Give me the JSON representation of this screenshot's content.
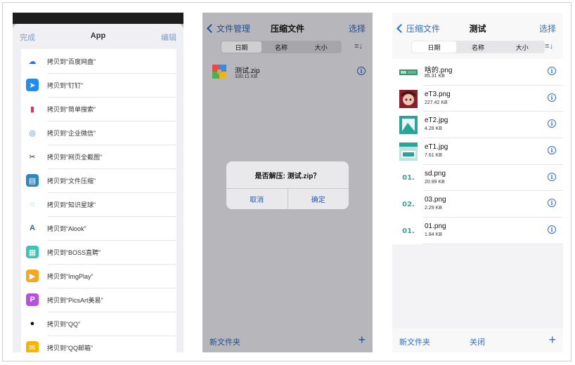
{
  "share_sheet": {
    "done": "完成",
    "title": "App",
    "edit": "编辑",
    "items": [
      {
        "label": "拷贝到“百度网盘”",
        "icon": "baidu-netdisk-icon",
        "color": "#ffffff",
        "fg": "#2b6be6",
        "glyph": "☁"
      },
      {
        "label": "拷贝到“钉钉”",
        "icon": "dingtalk-icon",
        "color": "#1e8cf0",
        "fg": "#ffffff",
        "glyph": "➤"
      },
      {
        "label": "拷贝到“简单搜索”",
        "icon": "simple-search-icon",
        "color": "#ffffff",
        "fg": "#e0306a",
        "glyph": "▮"
      },
      {
        "label": "拷贝到“企业微信”",
        "icon": "wecom-icon",
        "color": "#ffffff",
        "fg": "#3a8ef0",
        "glyph": "◎"
      },
      {
        "label": "拷贝到“网页全截图”",
        "icon": "scissors-icon",
        "color": "#ffffff",
        "fg": "#333333",
        "glyph": "✂"
      },
      {
        "label": "拷贝到“文件压缩”",
        "icon": "file-compress-icon",
        "color": "#2e86c1",
        "fg": "#ffffff",
        "glyph": "▤"
      },
      {
        "label": "拷贝到“知识星球”",
        "icon": "knowledge-planet-icon",
        "color": "#ffffff",
        "fg": "#3bc0a0",
        "glyph": "◌"
      },
      {
        "label": "拷贝到“Alook”",
        "icon": "alook-icon",
        "color": "#ffffff",
        "fg": "#2266cc",
        "glyph": "A"
      },
      {
        "label": "拷贝到“BOSS直聘”",
        "icon": "boss-zhipin-icon",
        "color": "#3cc4b4",
        "fg": "#ffffff",
        "glyph": "▦"
      },
      {
        "label": "拷贝到“ImgPlay”",
        "icon": "imgplay-icon",
        "color": "#f5a623",
        "fg": "#ffffff",
        "glyph": "▶"
      },
      {
        "label": "拷贝到“PicsArt美易”",
        "icon": "picsart-icon",
        "color": "#b84fe0",
        "fg": "#ffffff",
        "glyph": "P"
      },
      {
        "label": "拷贝到“QQ”",
        "icon": "qq-icon",
        "color": "#ffffff",
        "fg": "#111111",
        "glyph": "●"
      },
      {
        "label": "拷贝到“QQ邮箱”",
        "icon": "qq-mail-icon",
        "color": "#f7b500",
        "fg": "#ffffff",
        "glyph": "✉"
      }
    ]
  },
  "zip_view": {
    "back_label": "文件管理",
    "title": "压缩文件",
    "select": "选择",
    "segments": [
      "日期",
      "名称",
      "大小"
    ],
    "file": {
      "name": "测试.zip",
      "size": "330.11 KB"
    },
    "alert": {
      "message": "是否解压: 测试.zip？",
      "cancel": "取消",
      "confirm": "确定"
    },
    "new_folder": "新文件夹",
    "plus": "+"
  },
  "folder_view": {
    "back_label": "压缩文件",
    "title": "测试",
    "select": "选择",
    "segments": [
      "日期",
      "名称",
      "大小"
    ],
    "files": [
      {
        "name": "啥的.png",
        "size": "85.31 KB",
        "thumb": "green-strip"
      },
      {
        "name": "eT3.png",
        "size": "227.42 KB",
        "thumb": "anime"
      },
      {
        "name": "eT2.jpg",
        "size": "4.28 KB",
        "thumb": "teal-card"
      },
      {
        "name": "eT1.jpg",
        "size": "7.61 KB",
        "thumb": "teal-scene"
      },
      {
        "name": "sd.png",
        "size": "20.99 KB",
        "thumb": "text",
        "text": "01."
      },
      {
        "name": "03.png",
        "size": "2.29 KB",
        "thumb": "text",
        "text": "02."
      },
      {
        "name": "01.png",
        "size": "1.84 KB",
        "thumb": "text",
        "text": "01."
      }
    ],
    "new_folder": "新文件夹",
    "close": "关闭",
    "plus": "+"
  },
  "colors": {
    "ios_blue": "#2c6fd6",
    "dim_blue": "#1f4d8f"
  }
}
